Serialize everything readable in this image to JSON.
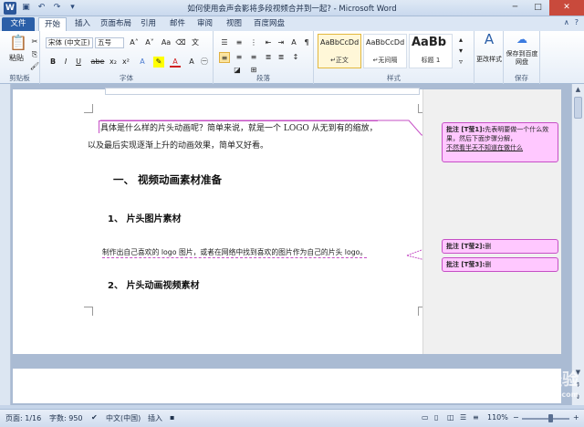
{
  "window": {
    "title": "如何使用会声会影将多段视频合并到一起? - Microsoft Word",
    "controls": [
      "─",
      "□",
      "✕"
    ]
  },
  "quick_access": [
    "save-icon",
    "undo-icon",
    "redo-icon"
  ],
  "tabs": [
    {
      "label": "文件",
      "active": false
    },
    {
      "label": "开始",
      "active": true
    },
    {
      "label": "插入",
      "active": false
    },
    {
      "label": "页面布局",
      "active": false
    },
    {
      "label": "引用",
      "active": false
    },
    {
      "label": "邮件",
      "active": false
    },
    {
      "label": "审阅",
      "active": false
    },
    {
      "label": "视图",
      "active": false
    },
    {
      "label": "百度网盘",
      "active": false
    }
  ],
  "ribbon": {
    "clipboard": {
      "paste": "粘贴",
      "label": "剪贴板"
    },
    "font": {
      "font_name": "宋体 (中文正)",
      "font_size": "五号",
      "grow": "A˄",
      "shrink": "A˅",
      "aa": "Aa",
      "bold": "B",
      "italic": "I",
      "underline": "U",
      "strike": "abe",
      "sub": "x₂",
      "sup": "x²",
      "label": "字体"
    },
    "paragraph": {
      "label": "段落"
    },
    "styles": {
      "items": [
        {
          "sample": "AaBbCcDd",
          "name": "↵正文"
        },
        {
          "sample": "AaBbCcDd",
          "name": "↵无间隔"
        },
        {
          "sample": "AaBb",
          "name": "标题 1"
        }
      ],
      "change": "更改样式",
      "label": "样式"
    },
    "save": {
      "button": "保存到百度网盘",
      "label": "保存"
    }
  },
  "document": {
    "p1_line1": "具体是什么样的片头动画呢？简单来说，就是一个 LOGO 从无到有的缩放，",
    "p1_line2": "以及最后实现逐渐上升的动画效果，简单又好看。",
    "h1": "一、    视频动画素材准备",
    "h2a": "1、     片头图片素材",
    "p2": "制作出自己喜欢的 logo 图片，或者在网络中找到喜欢的图片作为自己的片头 logo。",
    "h2b": "2、     片头动画视频素材"
  },
  "comments": [
    {
      "author": "批注 [T莹1]:",
      "text": "先表明要做一个什么效果，然后下面步骤分解，",
      "text2": "不然看半天不知道在做什么"
    },
    {
      "author": "批注 [T莹2]:",
      "text": "删"
    },
    {
      "author": "批注 [T莹3]:",
      "text": "删"
    }
  ],
  "status": {
    "page": "页面: 1/16",
    "words": "字数: 950",
    "lang": "中文(中国)",
    "insert": "插入",
    "zoom": "110%",
    "zoom_minus": "−",
    "zoom_plus": "+"
  },
  "watermark": {
    "main": "Baidu 经验",
    "sub": "jingyan.baidu.com"
  }
}
